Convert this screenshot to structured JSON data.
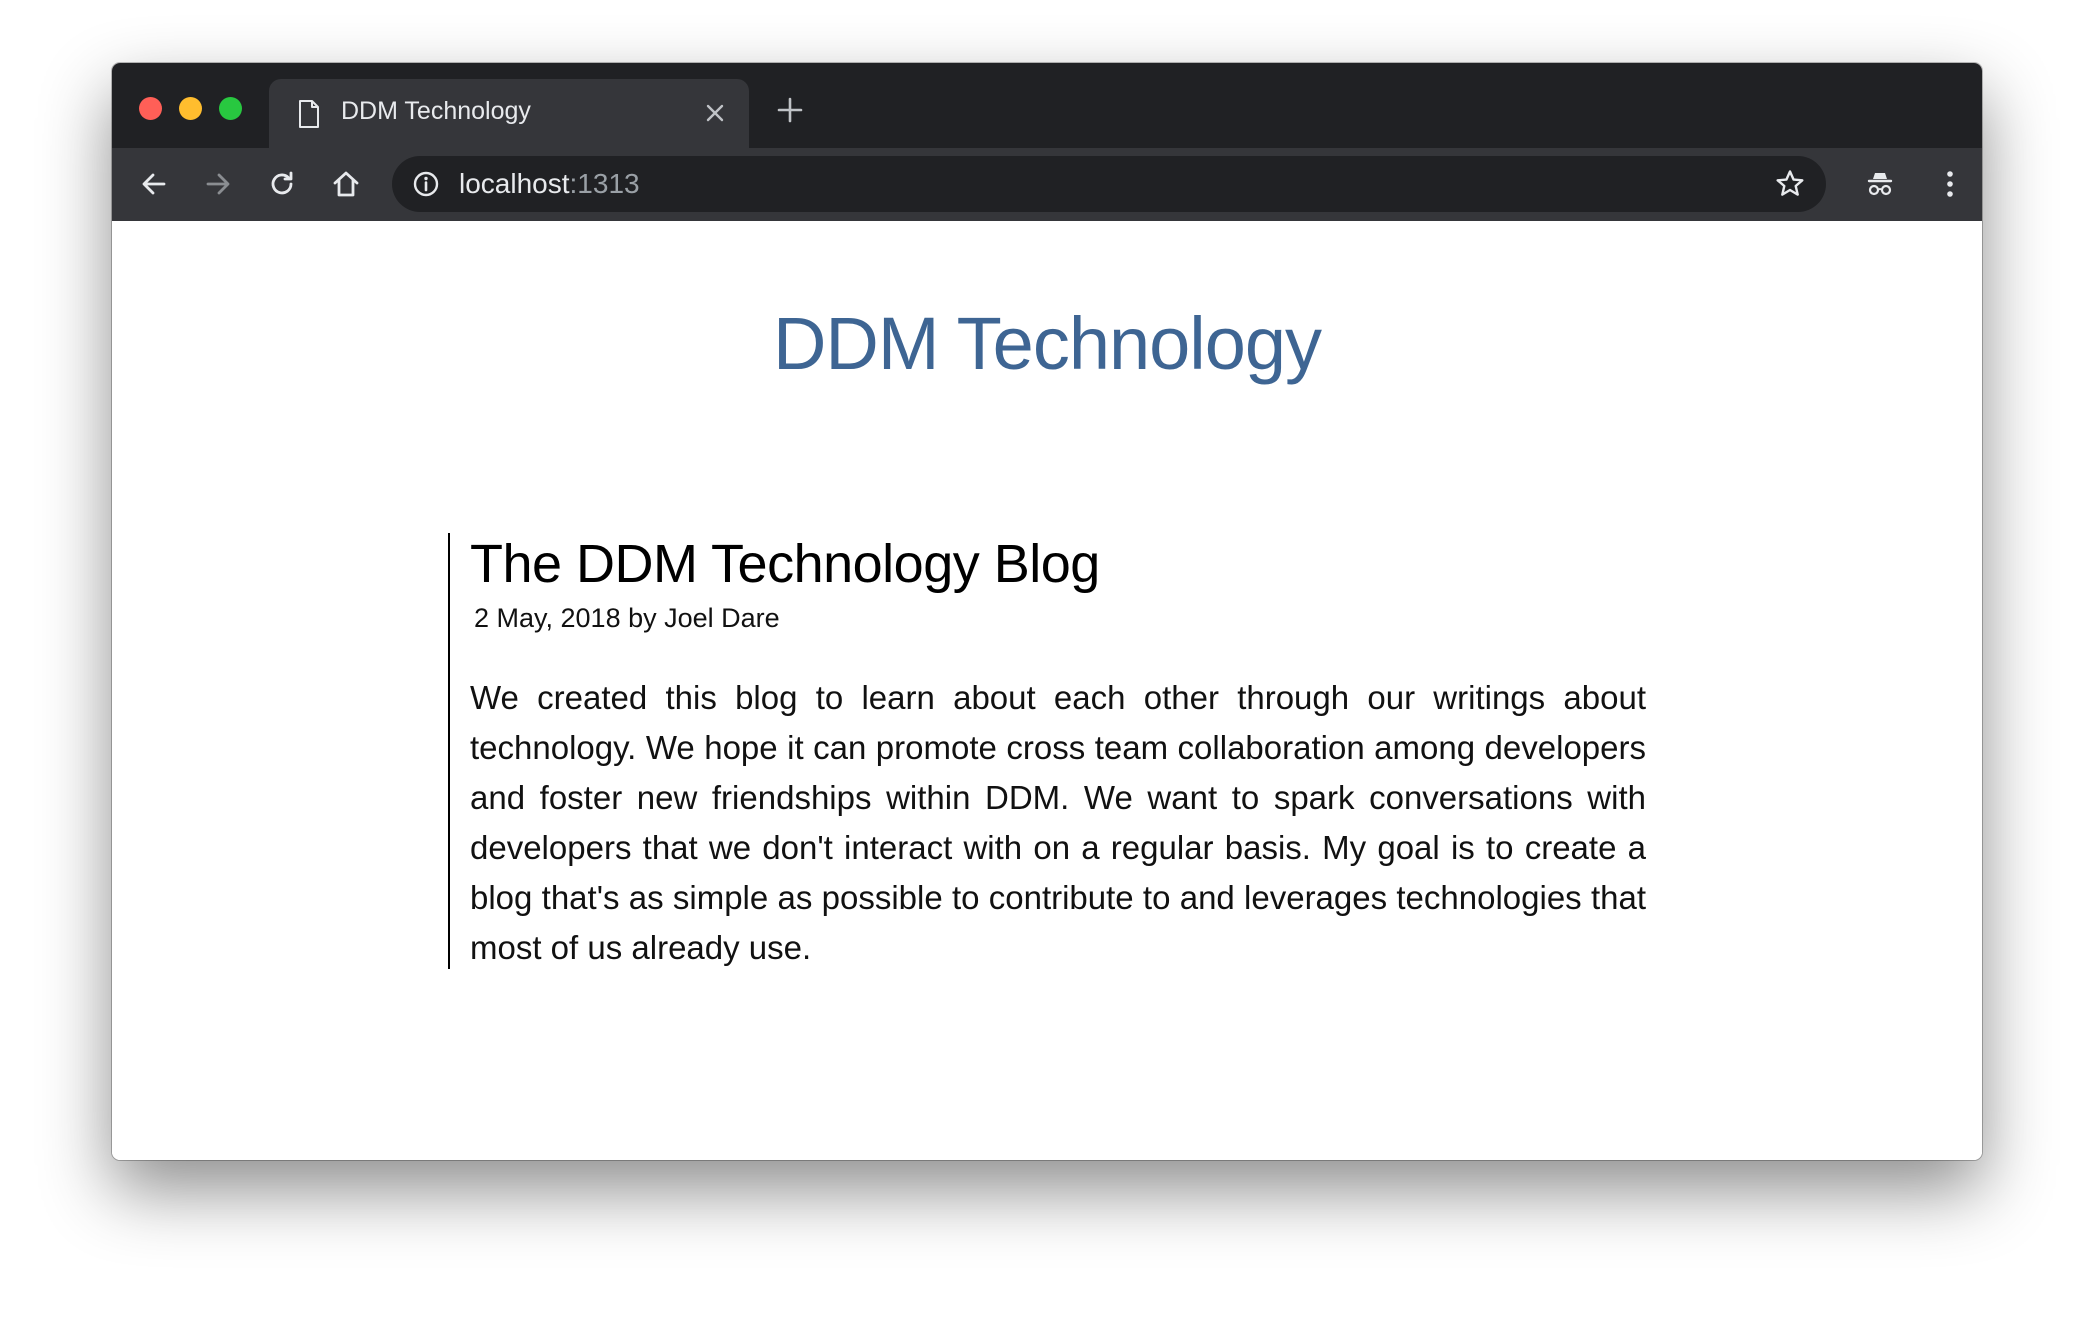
{
  "browser": {
    "tab": {
      "title": "DDM Technology",
      "icon": "document-icon"
    },
    "toolbar": {
      "back_icon": "arrow-left-icon",
      "forward_icon": "arrow-right-icon",
      "reload_icon": "reload-icon",
      "home_icon": "home-icon",
      "bookmark_icon": "star-icon",
      "incognito_icon": "incognito-icon",
      "menu_icon": "kebab-menu-icon"
    },
    "address_bar": {
      "host": "localhost",
      "port": ":1313",
      "security_icon": "info-icon"
    }
  },
  "page": {
    "site_title": "DDM Technology",
    "post": {
      "title": "The DDM Technology Blog",
      "meta": "2 May, 2018 by Joel Dare",
      "body": "We created this blog to learn about each other through our writings about technology. We hope it can promote cross team collaboration among developers and foster new friendships within DDM. We want to spark conversations with developers that we don't interact with on a regular basis. My goal is to create a blog that's as simple as possible to contribute to and leverages technologies that most of us already use."
    }
  },
  "colors": {
    "site_title": "#3e6593",
    "chrome_dark": "#202124",
    "chrome_toolbar": "#35363a"
  }
}
